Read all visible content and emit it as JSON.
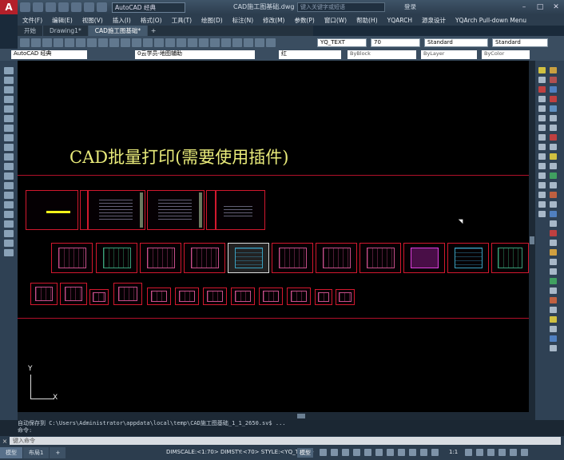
{
  "app": {
    "logo": "A",
    "workspace": "AutoCAD 经典",
    "doc_title": "CAD施工图基础.dwg",
    "search_placeholder": "键入关键字或短语",
    "signin": "登录"
  },
  "menu": [
    "文件(F)",
    "编辑(E)",
    "视图(V)",
    "插入(I)",
    "格式(O)",
    "工具(T)",
    "绘图(D)",
    "标注(N)",
    "修改(M)",
    "参数(P)",
    "窗口(W)",
    "帮助(H)",
    "YQARCH",
    "源泉设计",
    "YQArch Pull-down Menu"
  ],
  "tabs": [
    {
      "label": "开始",
      "active": false
    },
    {
      "label": "Drawing1*",
      "active": false
    },
    {
      "label": "CAD施工图基础*",
      "active": true
    }
  ],
  "toolbar1": {
    "text_style": "YQ_TEXT",
    "dim_scale": "70",
    "table_style": "Standard",
    "multileader_style": "Standard"
  },
  "toolbar2": {
    "workspace": "AutoCAD 经典",
    "layer": "0云学员-地图辅助",
    "color": "红",
    "linetype": "ByBlock",
    "lineweight": "ByLayer",
    "plotstyle": "ByColor"
  },
  "drawing": {
    "heading": "CAD批量打印(需要使用插件)",
    "ucs_x": "X",
    "ucs_y": "Y"
  },
  "command": {
    "history_line1": "自动保存到 C:\\Users\\Administrator\\appdata\\local\\temp\\CAD施工图基础_1_1_2650.sv$ ...",
    "history_line2": "命令:",
    "input_placeholder": "键入命令",
    "close": "×"
  },
  "status": {
    "tab_model": "模型",
    "tab_layout": "布局1",
    "text": "DIMSCALE:<1:70> DIMSTY:<70> STYLE:<YQ_TEXT>",
    "model": "模型",
    "scale": "1:1"
  },
  "colors": {
    "accent": "#b3202a",
    "frame_red": "#d2182e",
    "heading_yellow": "#e9eb7a"
  }
}
